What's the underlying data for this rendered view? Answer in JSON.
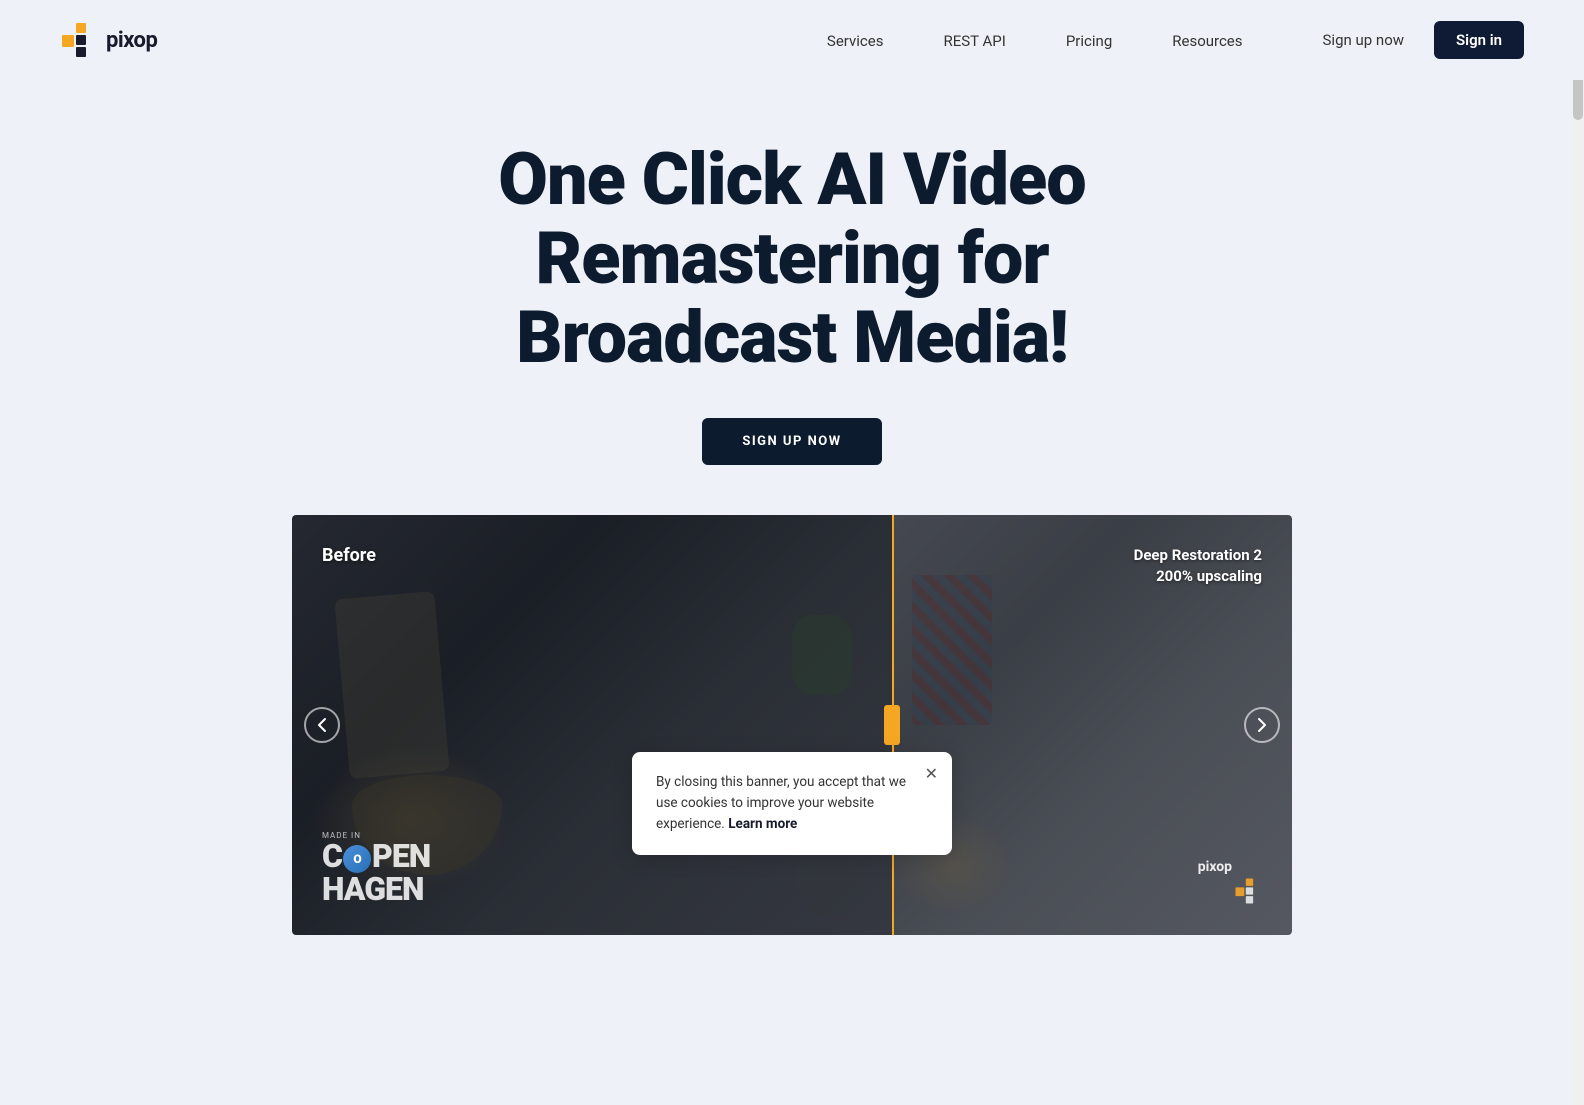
{
  "logo": {
    "text": "pixop",
    "alt": "Pixop logo"
  },
  "nav": {
    "links": [
      {
        "label": "Services",
        "href": "#"
      },
      {
        "label": "REST API",
        "href": "#"
      },
      {
        "label": "Pricing",
        "href": "#"
      },
      {
        "label": "Resources",
        "href": "#"
      }
    ],
    "auth": {
      "signup": "Sign up now",
      "signin": "Sign in"
    }
  },
  "hero": {
    "headline": "One Click AI Video Remastering for Broadcast Media!",
    "cta_label": "SIGN UP NOW"
  },
  "video_comparison": {
    "before_label": "Before",
    "after_label": "Deep Restoration 2\n200% upscaling"
  },
  "cookie_banner": {
    "text": "By closing this banner, you accept that we use cookies to improve your website experience.",
    "learn_more": "Learn more"
  },
  "watermark": {
    "city_prefix": "made in",
    "city_line1": "C",
    "city_letter_circle": "O",
    "city_line2": "PEN",
    "city_line3": "HAGEN",
    "pixop": "pixop"
  }
}
